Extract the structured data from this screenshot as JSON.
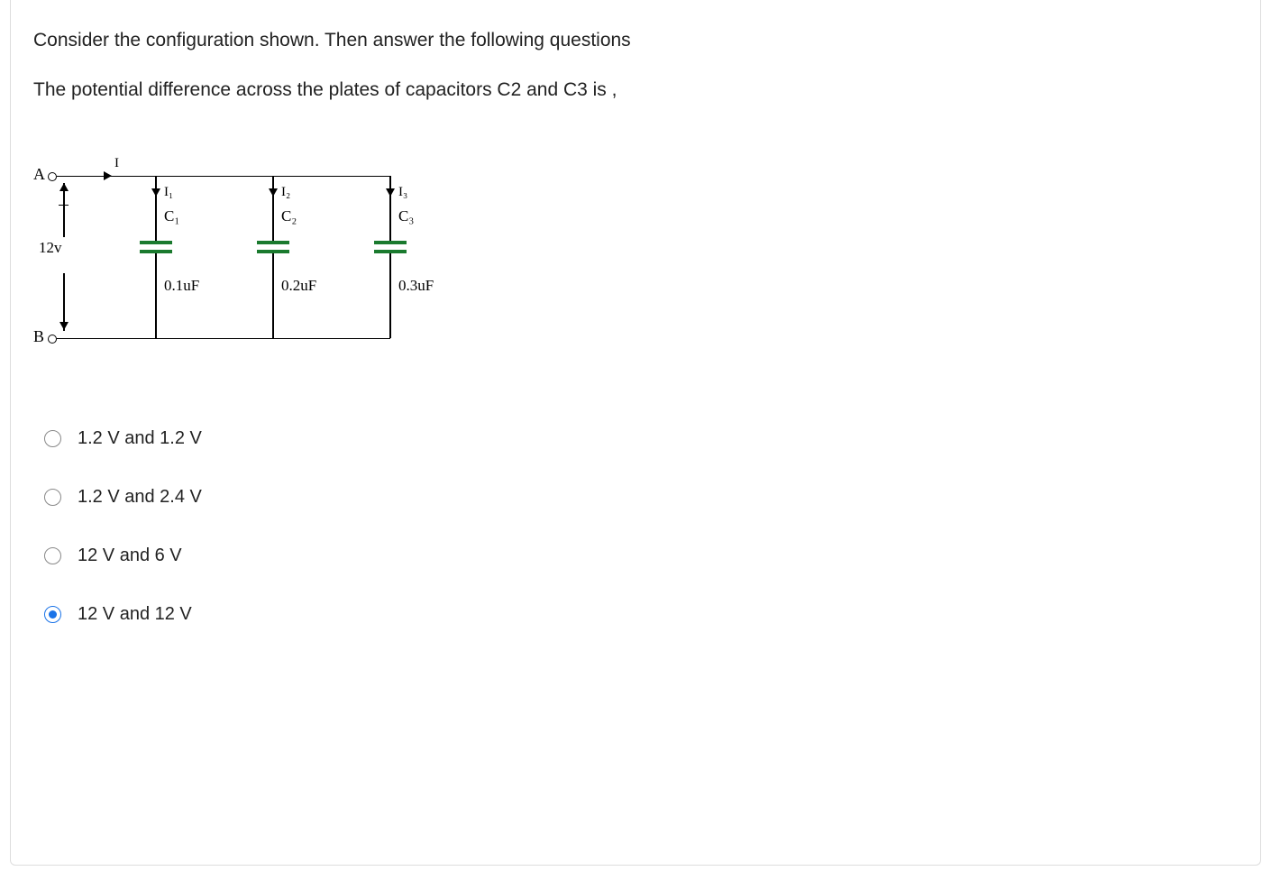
{
  "question": {
    "line1": "Consider the configuration shown.  Then  answer the following questions",
    "line2": "The potential difference across the plates of capacitors C2  and C3 is ,"
  },
  "diagram": {
    "nodeA": "A",
    "nodeB": "B",
    "source": "12v",
    "I": "I",
    "branches": [
      {
        "i_label": "I₁",
        "c_label": "C₁",
        "value": "0.1uF"
      },
      {
        "i_label": "I₂",
        "c_label": "C₂",
        "value": "0.2uF"
      },
      {
        "i_label": "I₃",
        "c_label": "C₃",
        "value": "0.3uF"
      }
    ]
  },
  "options": [
    {
      "label": "1.2 V and 1.2 V",
      "selected": false
    },
    {
      "label": "1.2 V and 2.4 V",
      "selected": false
    },
    {
      "label": "12 V and 6 V",
      "selected": false
    },
    {
      "label": "12 V and 12 V",
      "selected": true
    }
  ]
}
